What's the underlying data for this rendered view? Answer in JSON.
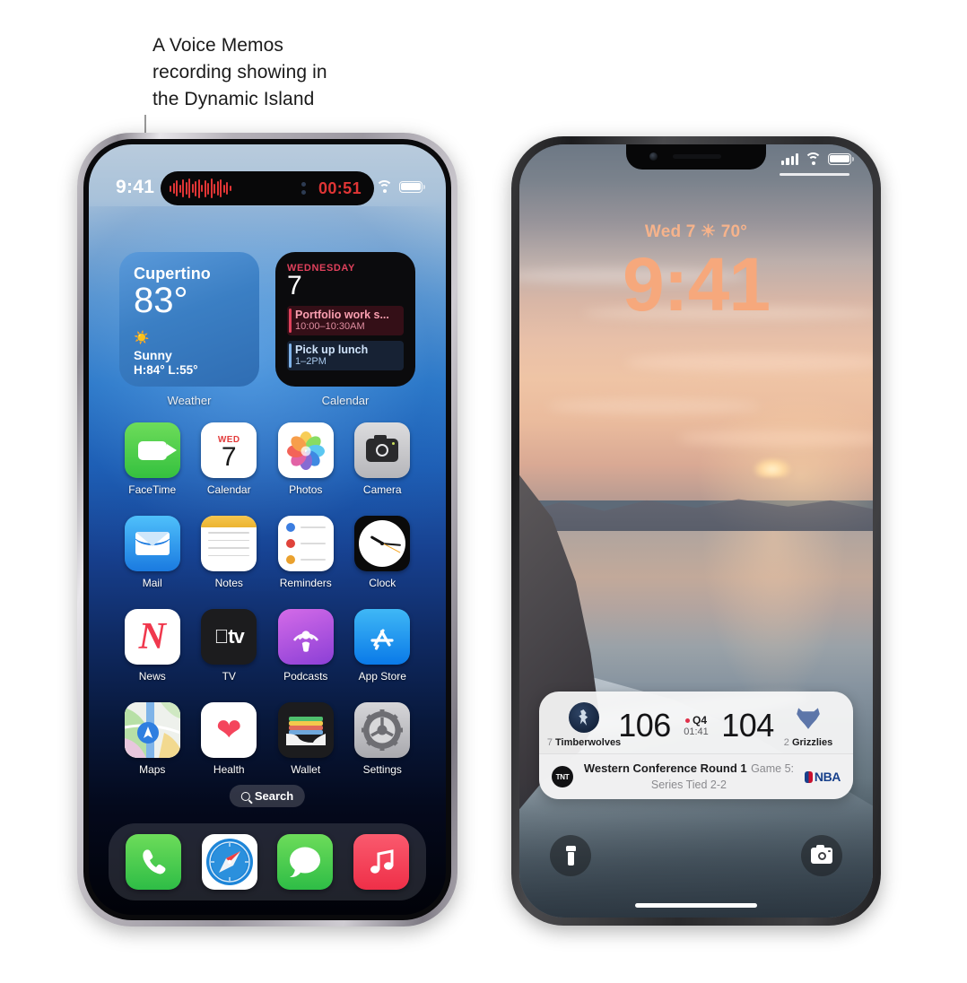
{
  "annotation": {
    "text": "A Voice Memos recording showing in the Dynamic Island",
    "line1": "A Voice Memos",
    "line2": "recording showing in",
    "line3": "the Dynamic Island"
  },
  "left_phone": {
    "device": "iPhone 14 Pro",
    "screen": "home-screen",
    "status_bar": {
      "time": "9:41",
      "wifi_icon": "wifi-icon",
      "battery_icon": "battery-full-icon"
    },
    "dynamic_island": {
      "app": "Voice Memos",
      "waveform_icon": "audio-waveform-icon",
      "waveform_color": "#e03535",
      "timer": "00:51",
      "timer_color": "#e03535"
    },
    "widgets": [
      {
        "name": "Weather",
        "label": "Weather",
        "city": "Cupertino",
        "temperature": "83°",
        "condition_icon": "sun-icon",
        "condition": "Sunny",
        "high_low": "H:84° L:55°"
      },
      {
        "name": "Calendar",
        "label": "Calendar",
        "weekday": "WEDNESDAY",
        "date": "7",
        "events": [
          {
            "title": "Portfolio work s...",
            "time": "10:00–10:30AM",
            "color": "#e0415c"
          },
          {
            "title": "Pick up lunch",
            "time": "1–2PM",
            "color": "#7fb3ea"
          }
        ]
      }
    ],
    "apps": [
      {
        "name": "FaceTime",
        "icon": "facetime-icon"
      },
      {
        "name": "Calendar",
        "icon": "calendar-icon",
        "weekday": "WED",
        "date": "7"
      },
      {
        "name": "Photos",
        "icon": "photos-icon"
      },
      {
        "name": "Camera",
        "icon": "camera-icon"
      },
      {
        "name": "Mail",
        "icon": "mail-icon"
      },
      {
        "name": "Notes",
        "icon": "notes-icon"
      },
      {
        "name": "Reminders",
        "icon": "reminders-icon"
      },
      {
        "name": "Clock",
        "icon": "clock-icon"
      },
      {
        "name": "News",
        "icon": "news-icon"
      },
      {
        "name": "TV",
        "icon": "tv-icon"
      },
      {
        "name": "Podcasts",
        "icon": "podcasts-icon"
      },
      {
        "name": "App Store",
        "icon": "app-store-icon"
      },
      {
        "name": "Maps",
        "icon": "maps-icon"
      },
      {
        "name": "Health",
        "icon": "health-icon"
      },
      {
        "name": "Wallet",
        "icon": "wallet-icon"
      },
      {
        "name": "Settings",
        "icon": "settings-icon"
      }
    ],
    "search": {
      "label": "Search",
      "icon": "search-icon"
    },
    "dock": [
      {
        "name": "Phone",
        "icon": "phone-icon"
      },
      {
        "name": "Safari",
        "icon": "safari-icon"
      },
      {
        "name": "Messages",
        "icon": "messages-icon"
      },
      {
        "name": "Music",
        "icon": "music-icon"
      }
    ]
  },
  "right_phone": {
    "device": "iPhone 13",
    "screen": "lock-screen",
    "status_bar": {
      "cellular_icon": "cellular-bars-icon",
      "wifi_icon": "wifi-icon",
      "battery_icon": "battery-full-icon"
    },
    "lock": {
      "date": "Wed 7",
      "weather_icon": "sun-icon",
      "temperature": "70°",
      "time": "9:41",
      "time_color": "#f6a87c"
    },
    "live_activity": {
      "app": "NBA",
      "away": {
        "seed": "7",
        "team": "Timberwolves",
        "score": "106",
        "logo": "timberwolves-logo"
      },
      "home": {
        "seed": "2",
        "team": "Grizzlies",
        "score": "104",
        "logo": "grizzlies-logo"
      },
      "period": "Q4",
      "game_clock": "01:41",
      "live_indicator": "live-dot",
      "broadcaster": "TNT",
      "series_title": "Western Conference Round 1",
      "series_subtitle": "Game 5: Series Tied 2-2",
      "league": "NBA"
    },
    "quick_actions": [
      {
        "name": "Flashlight",
        "icon": "flashlight-icon"
      },
      {
        "name": "Camera",
        "icon": "camera-icon"
      }
    ]
  }
}
